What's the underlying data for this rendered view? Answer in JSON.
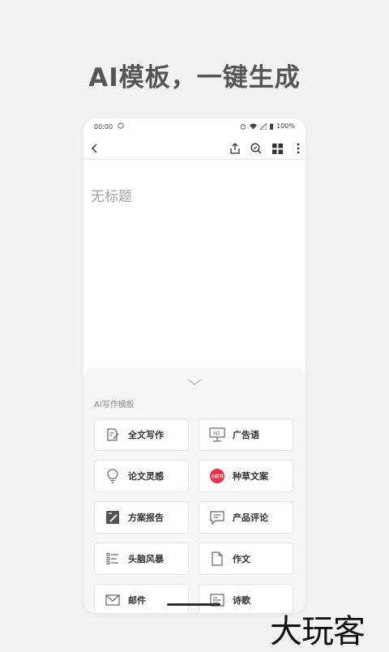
{
  "headline": "AI模板，一键生成",
  "statusbar": {
    "time": "00:00",
    "battery": "100%"
  },
  "document": {
    "title_placeholder": "无标题"
  },
  "sheet": {
    "section_label": "AI写作模板",
    "templates": [
      {
        "label": "全文写作",
        "icon": "edit-document-icon"
      },
      {
        "label": "广告语",
        "icon": "ad-board-icon"
      },
      {
        "label": "论文灵感",
        "icon": "lightbulb-icon"
      },
      {
        "label": "种草文案",
        "icon": "xiaohongshu-badge-icon",
        "badge_text": "小红书"
      },
      {
        "label": "方案报告",
        "icon": "report-icon"
      },
      {
        "label": "产品评论",
        "icon": "comment-icon"
      },
      {
        "label": "头脑风暴",
        "icon": "brainstorm-list-icon"
      },
      {
        "label": "作文",
        "icon": "file-icon"
      },
      {
        "label": "邮件",
        "icon": "mail-icon"
      },
      {
        "label": "诗歌",
        "icon": "poem-icon"
      }
    ]
  },
  "watermark": "大玩客",
  "colors": {
    "background": "#f3f2f3",
    "badge_red": "#e8344a"
  }
}
